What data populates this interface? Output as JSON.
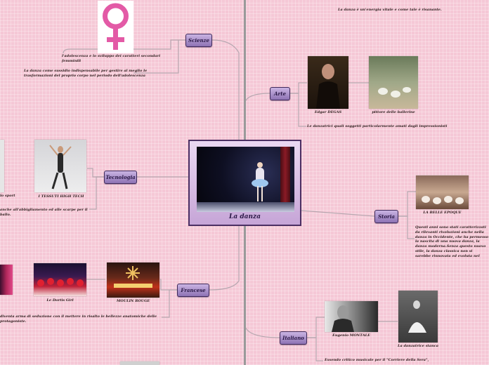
{
  "central": {
    "title": "La danza"
  },
  "branches": {
    "scienze": "Scienze",
    "tecnologia": "Tecnologia",
    "francese": "Francese",
    "arte": "Arte",
    "storia": "Storia",
    "italiano": "Italiano"
  },
  "scienze": {
    "text1": "l'adolescenza e lo sviluppo dei caratteri secondari femminili",
    "text2": "La danza come sussidio indispensabile per gestire al meglio le trasformazioni del proprio corpo nel periodo dell'adolescenza"
  },
  "tecnologia": {
    "left_caption": "lo sport",
    "caption": "I TESSUTI HIGH TECH",
    "text": "anche all'abbigliamento ed alle scarpe per il ballo."
  },
  "francese": {
    "caption1": "Le Dortis Girl",
    "caption2": "MOULIN ROUGE",
    "text": "diventa arma di seduzione con il mettere in risalto le bellezze anatomiche delle protagoniste."
  },
  "arte": {
    "top_text": "La danza è un'energia vitale e come tale è risanante.",
    "caption1": "Edgar DEGAS",
    "caption2": "pittore delle ballerine",
    "text": "Le danzatrici quali soggetti particolarmente amati dagli impressionisti"
  },
  "storia": {
    "caption": "LA BELLE EPOQUE",
    "text": "Questi anni sono stati caratterizzati da rilevanti rivoluzioni anche nella danza in Occidente, che ha permesso la nascita di una nuova danza, la danza moderna.Senza questo nuovo stile, la danza classica non si sarebbe rinnovata ed evoluta nel corso del Novecento."
  },
  "italiano": {
    "caption1": "Eugenio MONTALE",
    "caption2": "La danzatrice stanca",
    "text": "Essendo critico musicale per il \"Corriere della Sera\","
  },
  "colors": {
    "background": "#f5c8d6",
    "node_fill": "#a88bc9",
    "line": "#b7a7b0",
    "divider": "#9a9a9a"
  }
}
